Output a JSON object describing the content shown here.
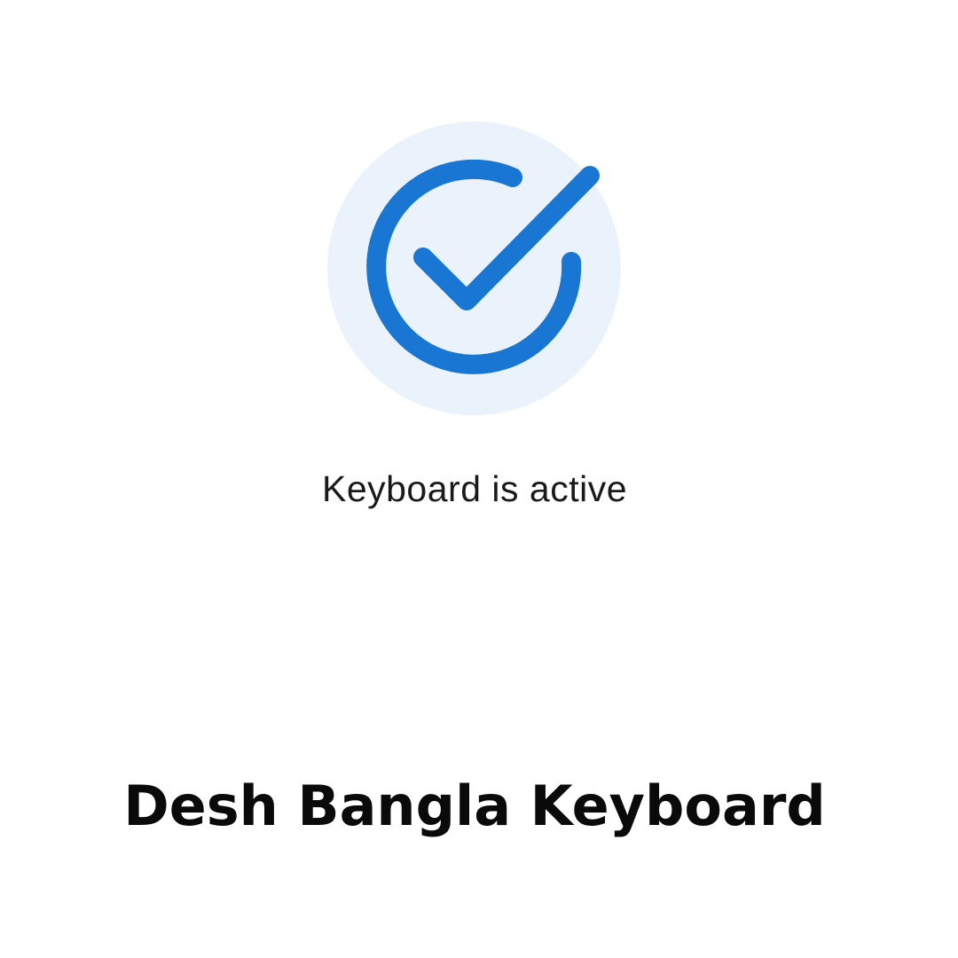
{
  "status": {
    "message": "Keyboard is active",
    "icon": "check-circle-icon",
    "accent_color": "#1976d2",
    "circle_bg_color": "#eaf3fb"
  },
  "app": {
    "name": "Desh Bangla Keyboard"
  }
}
